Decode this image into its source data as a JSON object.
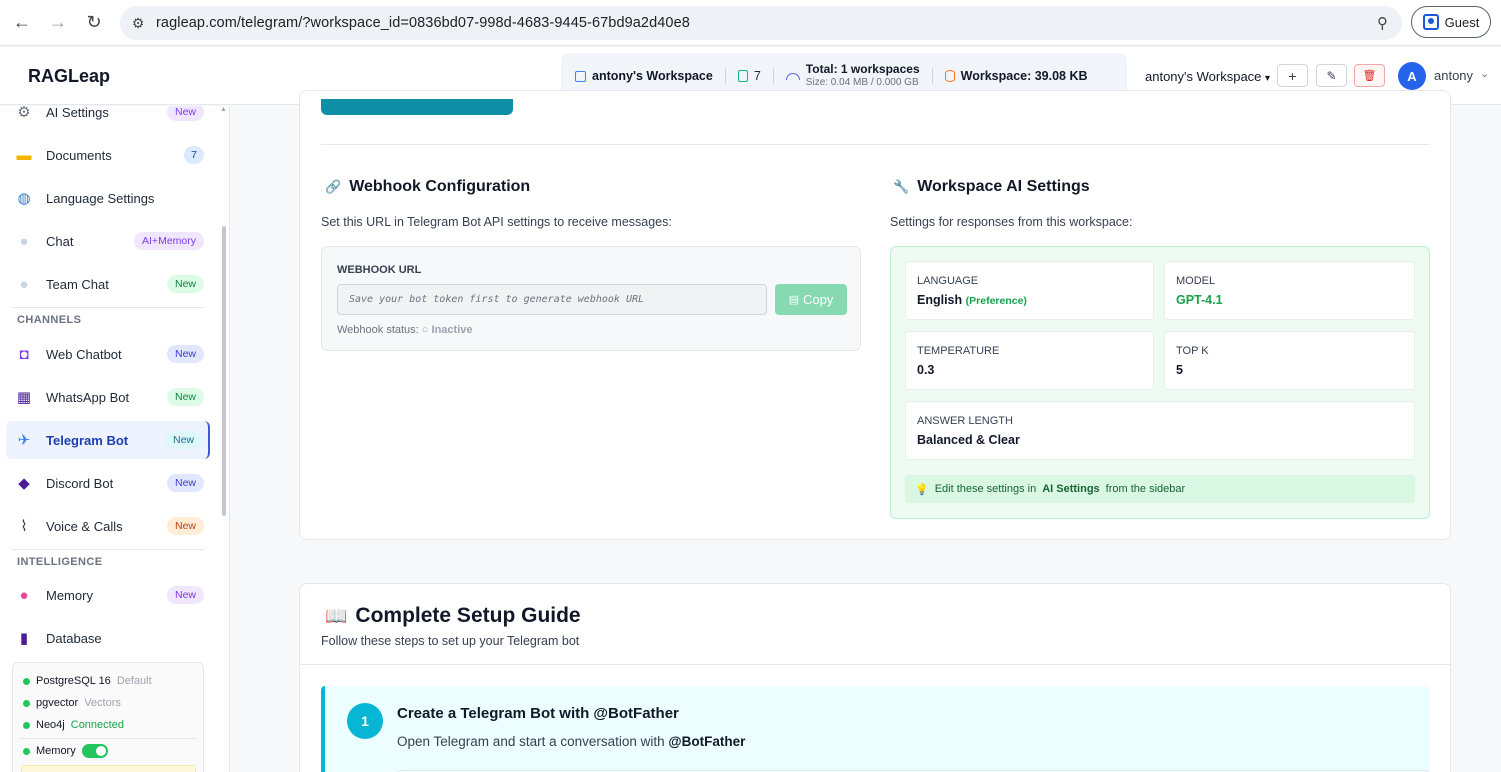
{
  "browser": {
    "url": "ragleap.com/telegram/?workspace_id=0836bd07-998d-4683-9445-67bd9a2d40e8",
    "profile_label": "Guest"
  },
  "header": {
    "logo": "RAGLeap",
    "workspace_name": "antony's Workspace",
    "doc_count": "7",
    "total_label": "Total: 1 workspaces",
    "size_label": "Size: 0.04 MB / 0.000 GB",
    "workspace_size": "Workspace: 39.08 KB",
    "workspace_select": "antony's Workspace",
    "add_btn": "+",
    "edit_btn": "✎",
    "delete_btn": "🗑",
    "avatar_initial": "A",
    "user_name": "antony"
  },
  "sidebar": {
    "items": [
      {
        "label": "AI Settings",
        "badge": "New"
      },
      {
        "label": "Documents",
        "badge": "7"
      },
      {
        "label": "Language Settings"
      },
      {
        "label": "Chat",
        "badge": "AI+Memory"
      },
      {
        "label": "Team Chat",
        "badge": "New"
      }
    ],
    "channels_label": "CHANNELS",
    "channels": [
      {
        "label": "Web Chatbot",
        "badge": "New"
      },
      {
        "label": "WhatsApp Bot",
        "badge": "New"
      },
      {
        "label": "Telegram Bot",
        "badge": "New"
      },
      {
        "label": "Discord Bot",
        "badge": "New"
      },
      {
        "label": "Voice & Calls",
        "badge": "New"
      }
    ],
    "intelligence_label": "INTELLIGENCE",
    "intelligence": [
      {
        "label": "Memory",
        "badge": "New"
      },
      {
        "label": "Database"
      }
    ],
    "db_status": [
      {
        "name": "PostgreSQL 16",
        "note": "Default"
      },
      {
        "name": "pgvector",
        "note": "Vectors"
      },
      {
        "name": "Neo4j",
        "note": "Connected"
      },
      {
        "name": "Memory",
        "note": ""
      }
    ]
  },
  "webhook": {
    "title": "Webhook Configuration",
    "desc": "Set this URL in Telegram Bot API settings to receive messages:",
    "url_label": "WEBHOOK URL",
    "url_placeholder": "Save your bot token first to generate webhook URL",
    "copy_label": "Copy",
    "status_label": "Webhook status:",
    "status_value": "Inactive"
  },
  "ai_settings": {
    "title": "Workspace AI Settings",
    "desc": "Settings for responses from this workspace:",
    "language_label": "LANGUAGE",
    "language_value": "English",
    "language_note": "(Preference)",
    "model_label": "MODEL",
    "model_value": "GPT-4.1",
    "temperature_label": "TEMPERATURE",
    "temperature_value": "0.3",
    "topk_label": "TOP K",
    "topk_value": "5",
    "answer_label": "ANSWER LENGTH",
    "answer_value": "Balanced & Clear",
    "tip_prefix": "Edit these settings in",
    "tip_link": "AI Settings",
    "tip_suffix": "from the sidebar"
  },
  "guide": {
    "title": "Complete Setup Guide",
    "subtitle": "Follow these steps to set up your Telegram bot",
    "step1_num": "1",
    "step1_title": "Create a Telegram Bot with @BotFather",
    "step1_desc_prefix": "Open Telegram and start a conversation with",
    "step1_desc_bold": "@BotFather"
  }
}
